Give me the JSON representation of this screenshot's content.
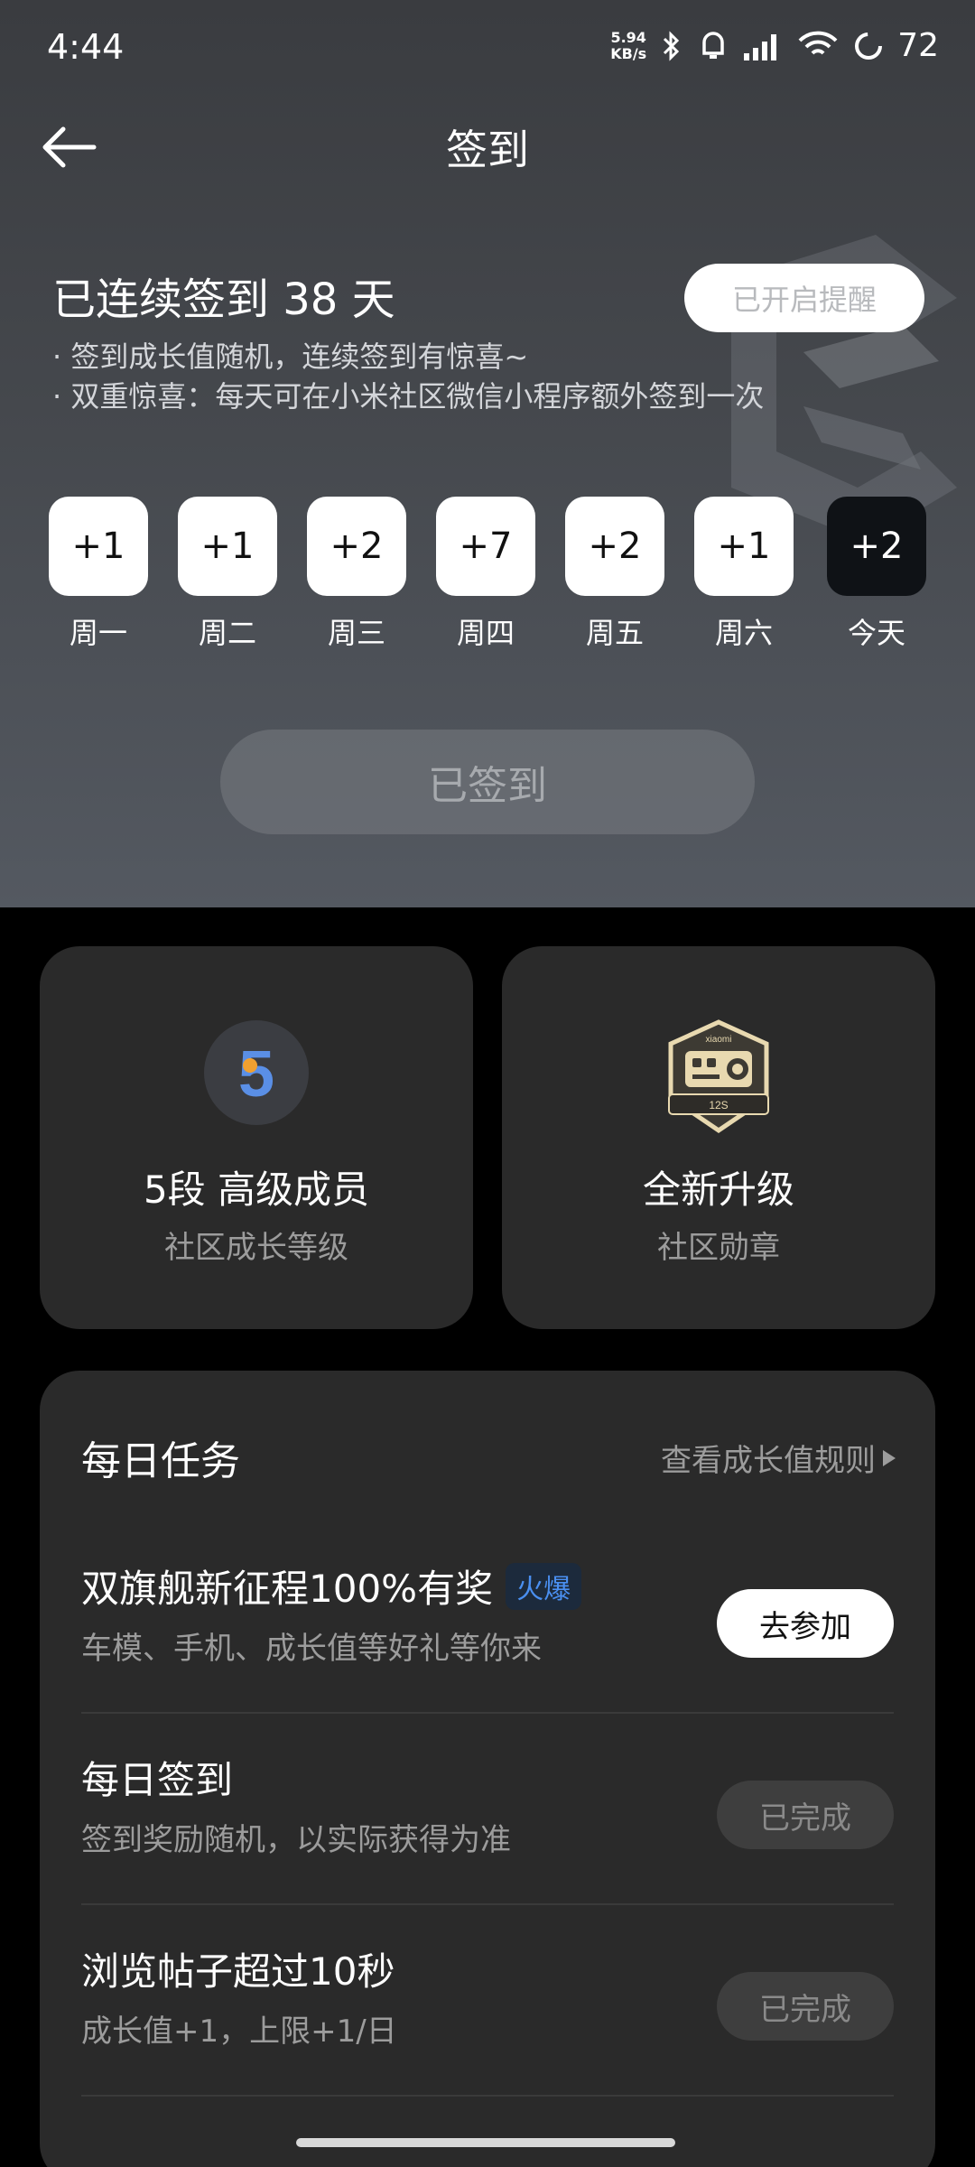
{
  "status_bar": {
    "time": "4:44",
    "net_speed_value": "5.94",
    "net_speed_unit": "KB/s",
    "battery": "72"
  },
  "nav": {
    "title": "签到"
  },
  "hero": {
    "streak_text": "已连续签到 38 天",
    "notice_1": "· 签到成长值随机，连续签到有惊喜~",
    "notice_2": "· 双重惊喜：每天可在小米社区微信小程序额外签到一次",
    "remind_label": "已开启提醒",
    "days": [
      {
        "value": "+1",
        "label": "周一"
      },
      {
        "value": "+1",
        "label": "周二"
      },
      {
        "value": "+2",
        "label": "周三"
      },
      {
        "value": "+7",
        "label": "周四"
      },
      {
        "value": "+2",
        "label": "周五"
      },
      {
        "value": "+1",
        "label": "周六"
      },
      {
        "value": "+2",
        "label": "今天"
      }
    ],
    "signed_label": "已签到"
  },
  "level_card": {
    "level_number": "5",
    "title": "5段 高级成员",
    "subtitle": "社区成长等级"
  },
  "badge_card": {
    "badge_brand": "xiaomi",
    "badge_model": "12S",
    "title": "全新升级",
    "subtitle": "社区勋章"
  },
  "tasks": {
    "title": "每日任务",
    "rules_link": "查看成长值规则",
    "items": [
      {
        "name": "双旗舰新征程100%有奖",
        "tag": "火爆",
        "desc": "车模、手机、成长值等好礼等你来",
        "button": "去参加",
        "state": "active"
      },
      {
        "name": "每日签到",
        "tag": "",
        "desc": "签到奖励随机，以实际获得为准",
        "button": "已完成",
        "state": "done"
      },
      {
        "name": "浏览帖子超过10秒",
        "tag": "",
        "desc": "成长值+1，上限+1/日",
        "button": "已完成",
        "state": "done"
      }
    ]
  },
  "colors": {
    "background": "#000000",
    "card": "#2a2a2a",
    "hot_tag": "#4a8ff0",
    "level_blue": "#5a8fe6",
    "level_orange": "#f0a030"
  }
}
